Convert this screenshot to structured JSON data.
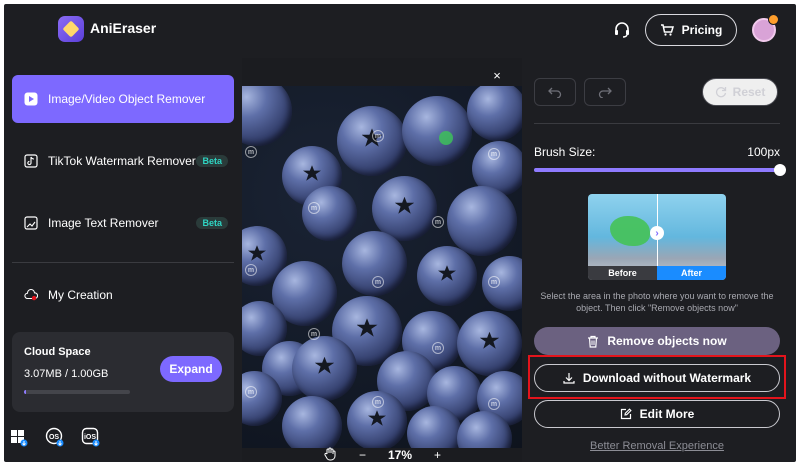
{
  "app": {
    "name": "AniEraser"
  },
  "header": {
    "pricing_label": "Pricing"
  },
  "sidebar": {
    "items": [
      {
        "label": "Image/Video Object Remover",
        "active": true
      },
      {
        "label": "TikTok Watermark Remover",
        "badge": "Beta"
      },
      {
        "label": "Image Text Remover",
        "badge": "Beta"
      },
      {
        "label": "My Creation"
      }
    ],
    "cloud": {
      "title": "Cloud Space",
      "usage": "3.07MB / 1.00GB",
      "used_fraction": 0.003,
      "expand_label": "Expand"
    },
    "platforms": [
      {
        "icon": "windows-icon"
      },
      {
        "icon": "macos-icon",
        "label": "OS"
      },
      {
        "icon": "ios-icon",
        "label": "iOS"
      }
    ]
  },
  "canvas": {
    "zoom": "17%",
    "minus": "−",
    "plus": "+",
    "close": "×",
    "watermark_letter": "m"
  },
  "panel": {
    "reset_label": "Reset",
    "brush_label": "Brush Size:",
    "brush_value": "100px",
    "brush_fraction": 1.0,
    "preview": {
      "before": "Before",
      "after": "After"
    },
    "hint": "Select the area in the photo where you want to remove the object. Then click \"Remove objects now\"",
    "remove_label": "Remove objects now",
    "download_label": "Download without Watermark",
    "edit_label": "Edit More",
    "better_link": "Better Removal Experience"
  },
  "colors": {
    "accent": "#7d69ff",
    "beta": "#2fd4c3",
    "highlight": "#e3141c"
  }
}
